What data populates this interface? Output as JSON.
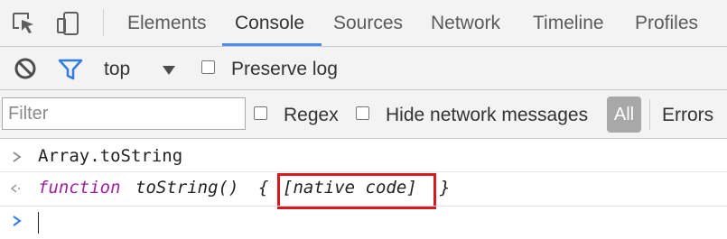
{
  "tabs": [
    {
      "label": "Elements",
      "active": false
    },
    {
      "label": "Console",
      "active": true
    },
    {
      "label": "Sources",
      "active": false
    },
    {
      "label": "Network",
      "active": false
    },
    {
      "label": "Timeline",
      "active": false
    },
    {
      "label": "Profiles",
      "active": false
    }
  ],
  "toolbar": {
    "context": "top",
    "preserve_log": "Preserve log"
  },
  "filter": {
    "placeholder": "Filter",
    "regex": "Regex",
    "hide_network": "Hide network messages",
    "level_all": "All",
    "level_errors": "Errors"
  },
  "console": {
    "input_line": "Array.toString",
    "output_keyword": "function",
    "output_name": "toString()",
    "output_open_brace": "{",
    "output_native": "[native code]",
    "output_close_brace": "}",
    "prompt_value": ""
  },
  "colors": {
    "accent": "#4a8cf0",
    "highlight": "#d9191c",
    "keyword": "#a020a0"
  },
  "icons": {
    "inspect": "inspect-element-icon",
    "device": "device-mode-icon",
    "clear": "clear-console-icon",
    "filter": "filter-icon",
    "dropdown": "dropdown-arrow-icon"
  }
}
